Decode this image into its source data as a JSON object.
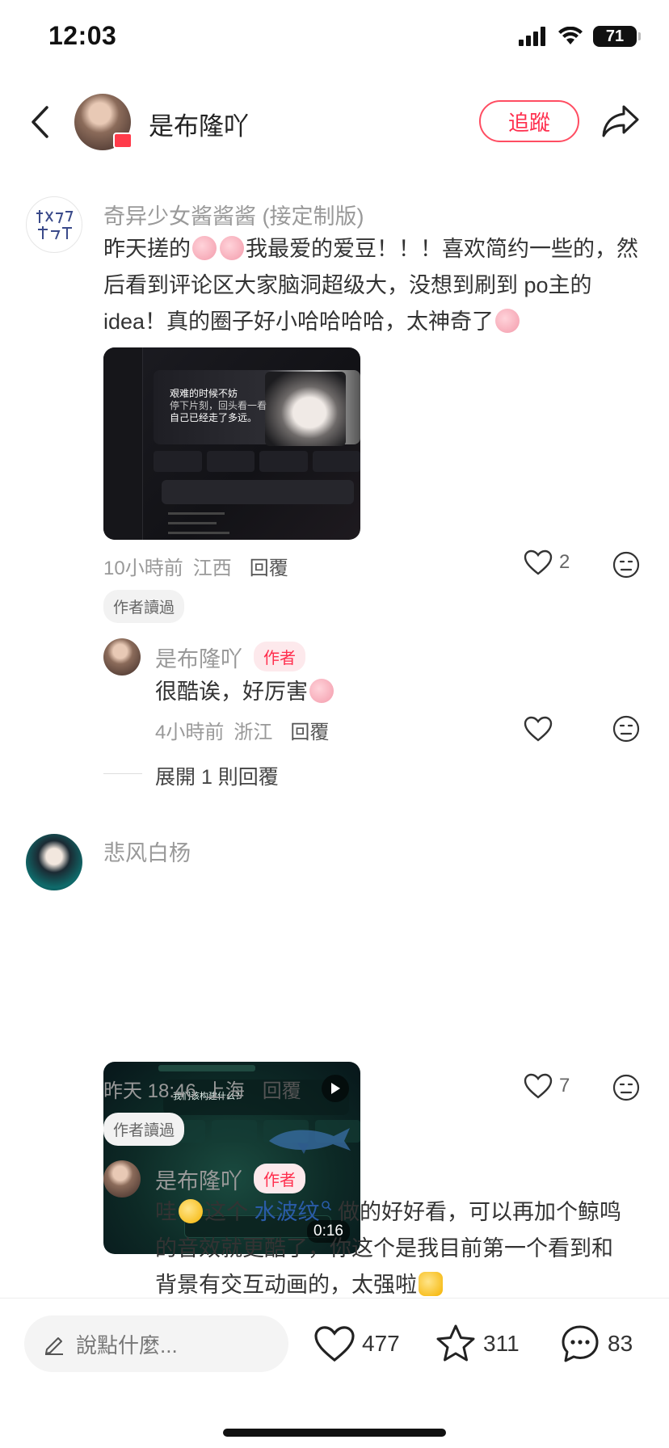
{
  "status_bar": {
    "time": "12:03",
    "battery": "71"
  },
  "header": {
    "username": "是布隆吖",
    "follow_label": "追蹤"
  },
  "comments": [
    {
      "username": "奇异少女酱酱酱 (接定制版)",
      "text_lines": [
        "昨天搓的",
        "我最爱的爱豆！！！喜欢简约一些的，然",
        "后看到评论区大家脑洞超级大，没想到刷到 po主的",
        "idea！真的圈子好小哈哈哈哈，太神奇了"
      ],
      "image_texts": [
        "艰难的时候不妨",
        "停下片刻，回头看一看",
        "自己已经走了多远。"
      ],
      "time": "10小時前",
      "location": "江西",
      "reply_label": "回覆",
      "likes": "2",
      "author_read": "作者讀過",
      "reply": {
        "username": "是布隆吖",
        "author_tag": "作者",
        "text": "很酷诶，好厉害",
        "time": "4小時前",
        "location": "浙江",
        "reply_label": "回覆"
      },
      "expand_label": "展開 1 則回覆"
    },
    {
      "username": "悲风白杨",
      "video_title": "我们该构建什么？",
      "video_duration": "0:16",
      "time": "昨天 18:46",
      "location": "上海",
      "reply_label": "回覆",
      "likes": "7",
      "author_read": "作者讀過",
      "reply": {
        "username": "是布隆吖",
        "author_tag": "作者",
        "text_prefix": "哇",
        "text_mid": "这个",
        "link_text": "水波纹",
        "text_line1_rest": "做的好好看，可以再加个鲸鸣",
        "text_line2": "的音效就更酷了，你这个是我目前第一个看到和",
        "text_line3": "背景有交互动画的，太强啦"
      }
    }
  ],
  "bottom_bar": {
    "input_placeholder": "說點什麼...",
    "likes": "477",
    "stars": "311",
    "comments": "83"
  },
  "colors": {
    "accent": "#ff2e4d",
    "link": "#2a5ca8"
  }
}
